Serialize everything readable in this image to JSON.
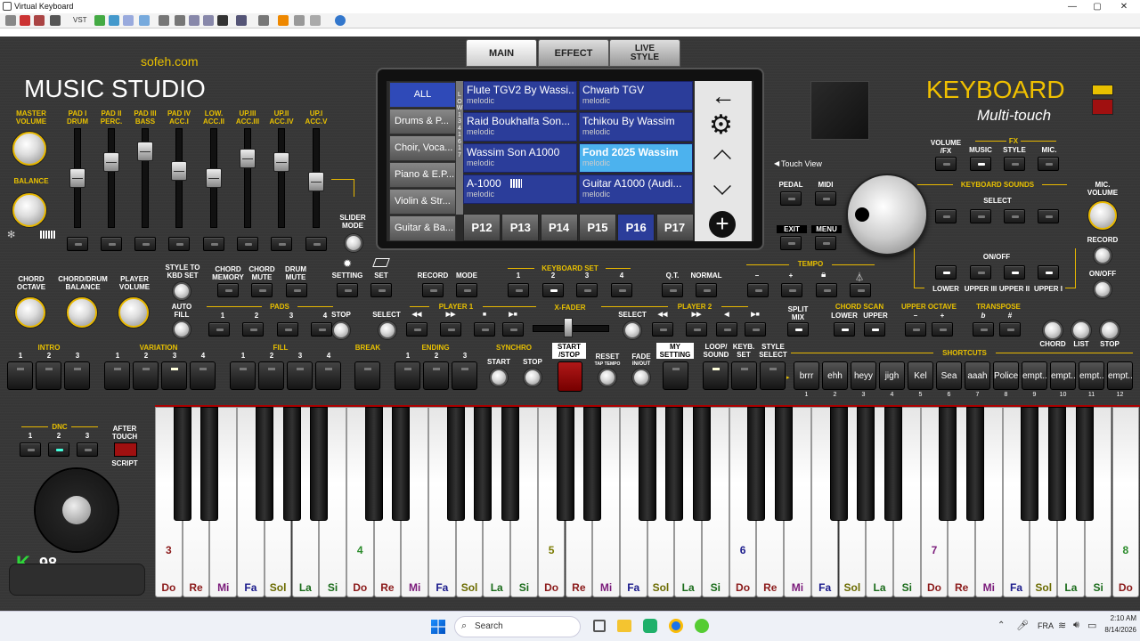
{
  "window": {
    "title": "Virtual Keyboard",
    "minimize": "—",
    "maximize": "▢",
    "close": "✕",
    "toolbar_vst": "VST"
  },
  "branding": {
    "site": "sofeh.com",
    "studio": "MUSIC STUDIO",
    "keyboard": "KEYBOARD",
    "subtitle": "Multi-touch"
  },
  "screen_tabs": [
    {
      "label": "MAIN",
      "active": true
    },
    {
      "label": "EFFECT"
    },
    {
      "label": "LIVE\nSTYLE"
    }
  ],
  "left": {
    "master_volume": "MASTER\nVOLUME",
    "balance": "BALANCE",
    "pads": [
      "PAD I\nDRUM",
      "PAD II\nPERC.",
      "PAD III\nBASS",
      "PAD IV\nACC.I",
      "LOW.\nACC.II",
      "UP.III\nACC.III",
      "UP.II\nACC.IV",
      "UP.I\nACC.V"
    ],
    "slider_mode": "SLIDER\nMODE",
    "chord_octave": "CHORD\nOCTAVE",
    "chord_drum_balance": "CHORD/DRUM\nBALANCE",
    "player_volume": "PLAYER\nVOLUME",
    "style_to_kbd": "STYLE TO\nKBD SET",
    "chord_memory": "CHORD\nMEMORY",
    "chord_mute": "CHORD\nMUTE",
    "drum_mute": "DRUM\nMUTE",
    "setting": "SETTING",
    "set": "SET",
    "auto_fill": "AUTO\nFILL",
    "pads_label": "PADS",
    "pads_nums": [
      "1",
      "2",
      "3",
      "4"
    ],
    "stop": "STOP",
    "record": "RECORD",
    "mode": "MODE"
  },
  "categories": [
    "ALL",
    "Drums & P...",
    "Choir, Voca...",
    "Piano & E.P...",
    "Violin & Str...",
    "Guitar & Ba..."
  ],
  "bank_strip": [
    "L",
    "O",
    "W",
    "1",
    "3",
    "4",
    "1",
    "6",
    "1",
    "7"
  ],
  "songs": [
    {
      "name": "Flute TGV2 By Wassi...",
      "sub": "melodic"
    },
    {
      "name": "Chwarb TGV",
      "sub": "melodic"
    },
    {
      "name": "Raid Boukhalfa Son...",
      "sub": "melodic"
    },
    {
      "name": "Tchikou By Wassim",
      "sub": "melodic"
    },
    {
      "name": "Wassim Son A1000",
      "sub": "melodic"
    },
    {
      "name": "Fond 2025 Wassim",
      "sub": "melodic",
      "selected": true
    },
    {
      "name": "A-1000",
      "sub": "melodic",
      "icon": "keyboard-icon"
    },
    {
      "name": "Guitar A1000 (Audi...",
      "sub": "melodic"
    }
  ],
  "pages": [
    "P12",
    "P13",
    "P14",
    "P15",
    "P16",
    "P17"
  ],
  "selected_page": "P16",
  "kbd_set": {
    "label": "KEYBOARD SET",
    "nums": [
      "1",
      "2",
      "3",
      "4"
    ]
  },
  "player1": {
    "label": "PLAYER 1",
    "select": "SELECT",
    "xfader": "X-FADER"
  },
  "player2": {
    "label": "PLAYER 2",
    "select": "SELECT"
  },
  "qt": "Q.T.",
  "normal": "NORMAL",
  "tempo": {
    "label": "TEMPO",
    "minus": "–",
    "plus": "+"
  },
  "touch_view": "Touch View",
  "pedal": "PEDAL",
  "midi": "MIDI",
  "exit": "EXIT",
  "menu": "MENU",
  "volume_fx": "VOLUME\n/FX",
  "fx": {
    "label": "FX",
    "music": "MUSIC",
    "style": "STYLE",
    "mic": "MIC."
  },
  "keyboard_sounds": {
    "label": "KEYBOARD SOUNDS",
    "select": "SELECT",
    "onoff": "ON/OFF",
    "lower": "LOWER",
    "upper3": "UPPER III",
    "upper2": "UPPER II",
    "upper1": "UPPER I"
  },
  "mic_volume": "MIC.\nVOLUME",
  "record_r": "RECORD",
  "onoff_r": "ON/OFF",
  "split_mix": "SPLIT\nMIX",
  "chord_scan": {
    "label": "CHORD SCAN",
    "lower": "LOWER",
    "upper": "UPPER"
  },
  "upper_octave": {
    "label": "UPPER OCTAVE",
    "minus": "–",
    "plus": "+"
  },
  "transpose": {
    "label": "TRANSPOSE",
    "flat": "b",
    "sharp": "#"
  },
  "right_knobs": [
    "CHORD",
    "LIST",
    "STOP"
  ],
  "bottom": {
    "intro": "INTRO",
    "variation": "VARIATION",
    "fill": "FILL",
    "break": "BREAK",
    "ending": "ENDING",
    "synchro": "SYNCHRO",
    "start": "START",
    "stop": "STOP",
    "start_stop": "START\n/STOP",
    "reset": "RESET",
    "tap_tempo": "TAP TEMPO",
    "fade": "FADE",
    "in_out": "IN/OUT",
    "my_setting": "MY\nSETTING",
    "loop_sound": "LOOP/\nSOUND",
    "keyb_set": "KEYB.\nSET",
    "style_select": "STYLE\nSELECT",
    "shortcuts": "SHORTCUTS",
    "nums3": [
      "1",
      "2",
      "3"
    ],
    "nums4": [
      "1",
      "2",
      "3",
      "4"
    ]
  },
  "shortcuts": [
    "brrr",
    "ehh",
    "heyy",
    "jigh",
    "Kel",
    "Sea",
    "aaah",
    "Police",
    "empt...",
    "empt...",
    "empt...",
    "empt..."
  ],
  "shortcut_nums": [
    "1",
    "2",
    "3",
    "4",
    "5",
    "6",
    "7",
    "8",
    "9",
    "10",
    "11",
    "12"
  ],
  "dnc": {
    "label": "DNC",
    "nums": [
      "1",
      "2",
      "3"
    ],
    "after_touch": "AFTER\nTOUCH",
    "script": "SCRIPT"
  },
  "velocity": "98",
  "notes": [
    "Do",
    "Re",
    "Mi",
    "Fa",
    "Sol",
    "La",
    "Si"
  ],
  "octaves": [
    "3",
    "4",
    "5",
    "6",
    "7",
    "8"
  ],
  "note_colors": {
    "Do": "#8b1a1a",
    "Re": "#8b1a1a",
    "Mi": "#7a1a7a",
    "Fa": "#1a1a8b",
    "Sol": "#6b6b00",
    "La": "#1a6b1a",
    "Si": "#1a6b1a"
  },
  "taskbar": {
    "search": "Search",
    "lang": "FRA",
    "time": "2:10 AM",
    "date": "8/14/2026"
  }
}
